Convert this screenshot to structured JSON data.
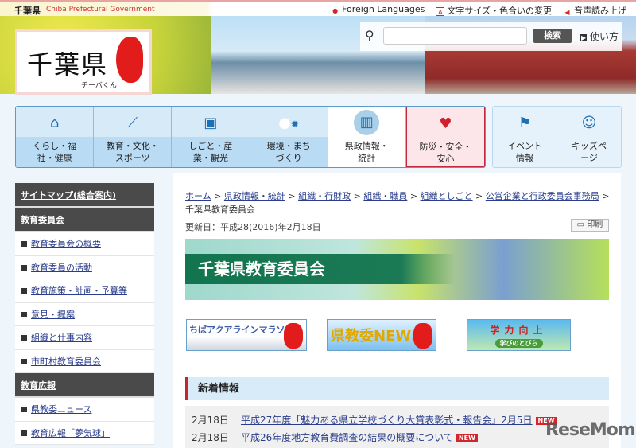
{
  "topbar": {
    "site": "千葉県",
    "site_en": "Chiba Prefectural Government",
    "links": [
      "Foreign Languages",
      "文字サイズ・色合いの変更",
      "音声読み上げ"
    ]
  },
  "header": {
    "logo_text": "千葉県",
    "mascot": "チーバくん",
    "search_placeholder": "",
    "search_button": "検索",
    "howto": "使い方"
  },
  "nav": [
    {
      "label": "くらし・福\n社・健康",
      "icon": "house-icon"
    },
    {
      "label": "教育・文化・\nスポーツ",
      "icon": "bat-icon"
    },
    {
      "label": "しごと・産\n業・観光",
      "icon": "briefcase-icon"
    },
    {
      "label": "環境・まち\nづくり",
      "icon": "tree-sun-icon"
    },
    {
      "label": "県政情報・\n統計",
      "icon": "building-icon"
    },
    {
      "label": "防災・安全・\n安心",
      "icon": "heart-icon"
    }
  ],
  "nav2": [
    {
      "label": "イベント\n情報",
      "icon": "flag-icon"
    },
    {
      "label": "キッズペ\nージ",
      "icon": "kid-face-icon"
    }
  ],
  "sidebar": {
    "sitemap": "サイトマップ(総合案内)",
    "sections": [
      {
        "title": "教育委員会",
        "items": [
          "教育委員会の概要",
          "教育委員の活動",
          "教育施策・計画・予算等",
          "意見・提案",
          "組織と仕事内容",
          "市町村教育委員会"
        ]
      },
      {
        "title": "教育広報",
        "items": [
          "県教委ニュース",
          "教育広報「夢気球」"
        ]
      }
    ]
  },
  "breadcrumb": {
    "links": [
      "ホーム",
      "県政情報・統計",
      "組織・行財政",
      "組織・職員",
      "組織としごと",
      "公営企業と行政委員会事務局"
    ],
    "current": "千葉県教育委員会"
  },
  "updated": "更新日：平成28(2016)年2月18日",
  "print": "印刷",
  "banner_title": "千葉県教育委員会",
  "sub_banners": [
    "ちばアクアラインマラソン",
    "県教委NEWS",
    "学力向上"
  ],
  "sub_banner3_sub": "学びのとびら",
  "news": {
    "title": "新着情報",
    "new_badge": "NEW",
    "items": [
      {
        "date": "2月18日",
        "text": "平成27年度「魅力ある県立学校づくり大賞表彰式・報告会」2月5日"
      },
      {
        "date": "2月18日",
        "text": "平成26年度地方教育費調査の結果の概要について"
      }
    ]
  },
  "watermark": "ReseMom"
}
